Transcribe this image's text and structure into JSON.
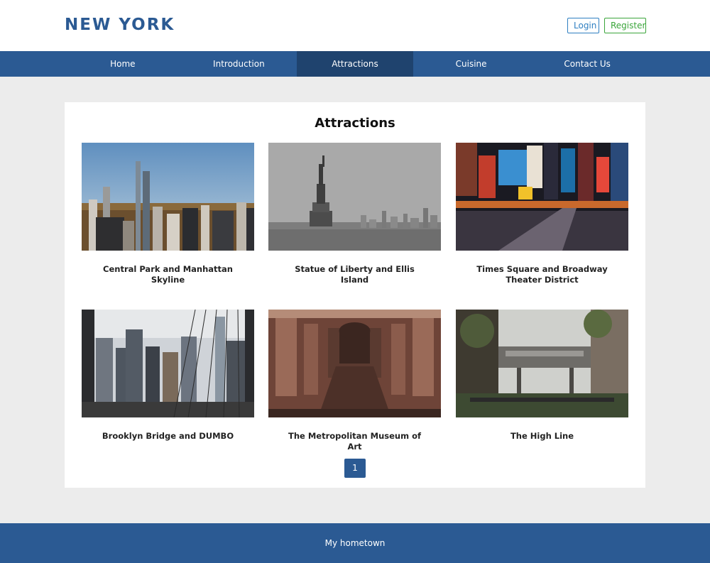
{
  "header": {
    "brand": "NEW YORK",
    "login_label": "Login",
    "register_label": "Register"
  },
  "nav": {
    "items": [
      {
        "label": "Home"
      },
      {
        "label": "Introduction"
      },
      {
        "label": "Attractions"
      },
      {
        "label": "Cuisine"
      },
      {
        "label": "Contact Us"
      }
    ],
    "active": "Attractions"
  },
  "main": {
    "title": "Attractions",
    "cards": [
      {
        "title": "Central Park and Manhattan Skyline",
        "image": "central-park-skyline-image"
      },
      {
        "title": "Statue of Liberty and Ellis Island",
        "image": "statue-of-liberty-image"
      },
      {
        "title": "Times Square and Broadway Theater District",
        "image": "times-square-image"
      },
      {
        "title": "Brooklyn Bridge and DUMBO",
        "image": "brooklyn-bridge-image"
      },
      {
        "title": "The Metropolitan Museum of Art",
        "image": "metropolitan-museum-image"
      },
      {
        "title": "The High Line",
        "image": "high-line-image"
      }
    ],
    "pagination": {
      "current_page": "1"
    }
  },
  "footer": {
    "text": "My hometown"
  },
  "colors": {
    "brand_blue": "#2b5a93",
    "nav_active": "#1f436e",
    "login_blue": "#2e7fc1",
    "register_green": "#3aa53a",
    "page_background": "#ececec"
  }
}
